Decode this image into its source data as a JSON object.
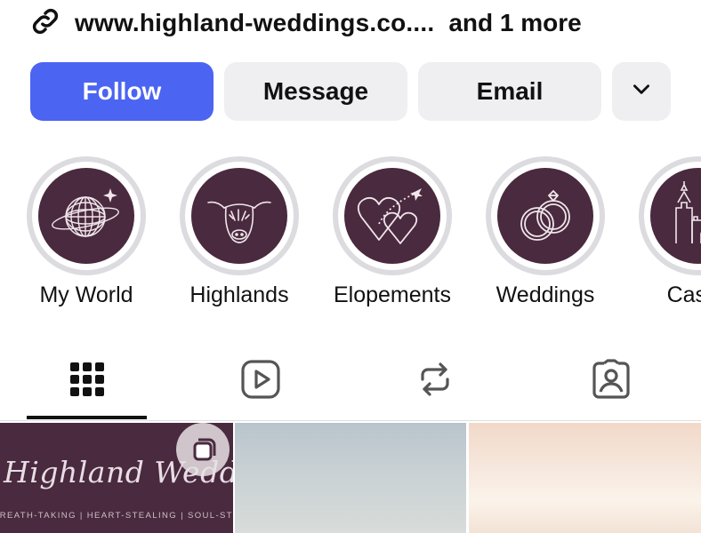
{
  "profile": {
    "link_text": "www.highland-weddings.co....",
    "link_more": "and 1 more"
  },
  "actions": {
    "follow": "Follow",
    "message": "Message",
    "email": "Email"
  },
  "highlights": [
    {
      "label": "My World",
      "icon": "disco-ball-icon"
    },
    {
      "label": "Highlands",
      "icon": "highland-cow-icon"
    },
    {
      "label": "Elopements",
      "icon": "hearts-plane-icon"
    },
    {
      "label": "Weddings",
      "icon": "wedding-rings-icon"
    },
    {
      "label": "Castle",
      "icon": "castle-icon"
    }
  ],
  "tabs": [
    {
      "name": "grid",
      "icon": "grid-icon",
      "active": true
    },
    {
      "name": "reels",
      "icon": "reels-icon"
    },
    {
      "name": "reposts",
      "icon": "repost-icon"
    },
    {
      "name": "tagged",
      "icon": "tagged-icon"
    }
  ],
  "posts": {
    "first_title": "Highland Weddings",
    "first_tagline": "BREATH-TAKING | HEART-STEALING | SOUL-STIRRING"
  },
  "colors": {
    "accent": "#4b64f2",
    "highlight_bg": "#4a2a3e"
  }
}
